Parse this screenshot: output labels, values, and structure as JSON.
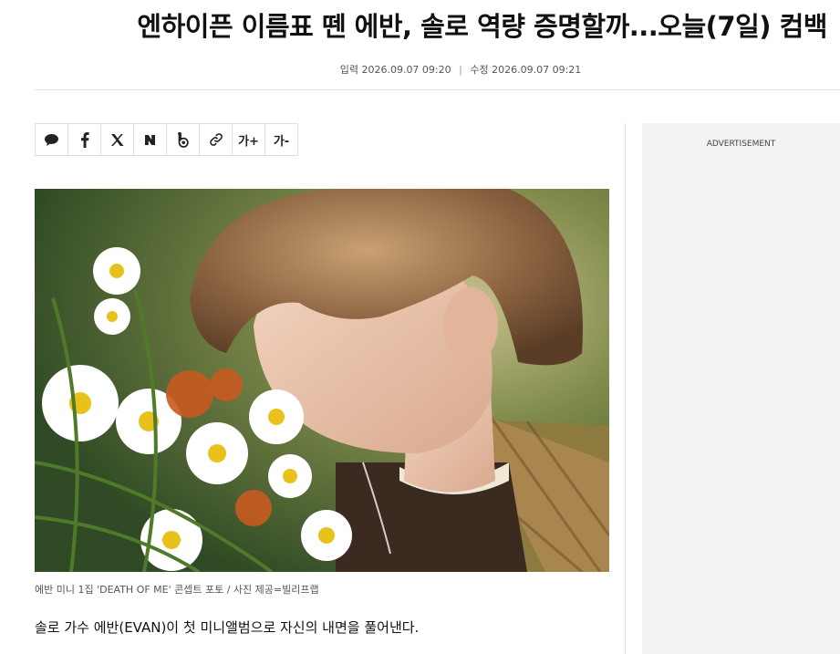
{
  "article": {
    "headline": "엔하이픈 이름표 뗀 에반, 솔로 역량 증명할까...오늘(7일) 컴백",
    "published_label": "입력",
    "published_time": "2026.09.07 09:20",
    "updated_label": "수정",
    "updated_time": "2026.09.07 09:21",
    "photo_caption": "에반 미니 1집 'DEATH OF ME' 콘셉트 포토 / 사진 제공=빌리프랩",
    "lead_text": "솔로 가수 에반(EVAN)이 첫 미니앨범으로 자신의 내면을 풀어낸다."
  },
  "share": {
    "font_up_label": "가+",
    "font_down_label": "가-",
    "icons": [
      "comment-icon",
      "facebook-icon",
      "x-icon",
      "naver-icon",
      "band-icon",
      "link-icon"
    ]
  },
  "sidebar": {
    "ad_label": "ADVERTISEMENT",
    "background": "#f3f3f3"
  },
  "colors": {
    "text": "#111111",
    "meta": "#555555",
    "border": "#dedede"
  }
}
